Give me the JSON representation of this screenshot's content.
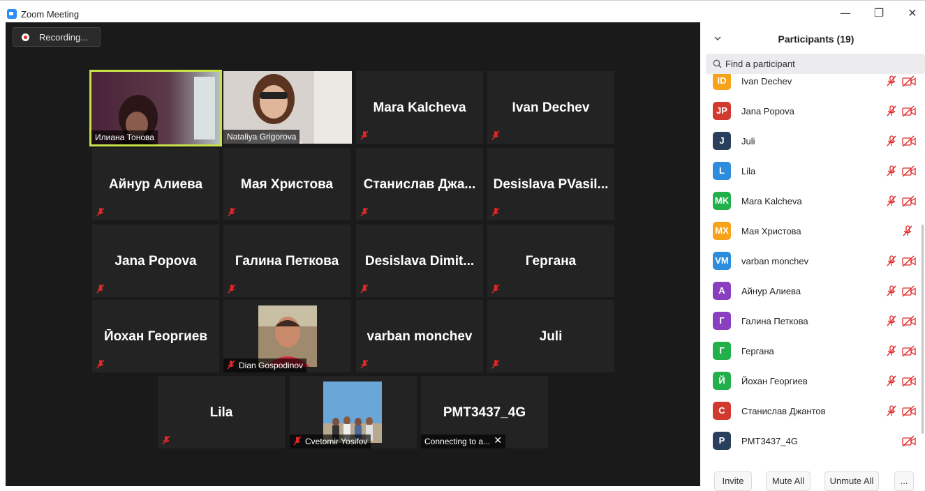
{
  "window": {
    "title": "Zoom Meeting",
    "minimize": "—",
    "restore": "❐",
    "close": "✕"
  },
  "recording": {
    "label": "Recording..."
  },
  "grid": {
    "tiles": [
      {
        "name": "Илиана Тонова",
        "label": "Илиана Тонова",
        "type": "video",
        "active": true
      },
      {
        "name": "Nataliya Grigorova",
        "label": "Nataliya Grigorova",
        "type": "video"
      },
      {
        "name": "Mara Kalcheva",
        "type": "name",
        "muted": true
      },
      {
        "name": "Ivan Dechev",
        "type": "name",
        "muted": true
      },
      {
        "name": "Айнур Алиева",
        "type": "name",
        "muted": true
      },
      {
        "name": "Мая Христова",
        "type": "name",
        "muted": true
      },
      {
        "name": "Станислав  Джа...",
        "type": "name",
        "muted": true
      },
      {
        "name": "Desislava  PVasil...",
        "type": "name",
        "muted": true
      },
      {
        "name": "Jana Popova",
        "type": "name",
        "muted": true
      },
      {
        "name": "Галина Петкова",
        "type": "name",
        "muted": true
      },
      {
        "name": "Desislava  Dimit...",
        "type": "name",
        "muted": true
      },
      {
        "name": "Гергана",
        "type": "name",
        "muted": true
      },
      {
        "name": "Йохан Георгиев",
        "type": "name",
        "muted": true
      },
      {
        "name": "Dian Gospodinov",
        "label": "Dian Gospodinov",
        "type": "video",
        "muted": true
      },
      {
        "name": "varban monchev",
        "type": "name",
        "muted": true
      },
      {
        "name": "Juli",
        "type": "name",
        "muted": true
      },
      {
        "name": "Lila",
        "type": "name",
        "muted": true
      },
      {
        "name": "Cvetomir Yosifov",
        "label": "Cvetomir Yosifov",
        "type": "video",
        "muted": true
      },
      {
        "name": "PMT3437_4G",
        "label": "Connecting to a...",
        "type": "connecting"
      }
    ]
  },
  "panel": {
    "title": "Participants (19)",
    "search_placeholder": "Find a participant",
    "participants": [
      {
        "initials": "ID",
        "name": "Ivan Dechev",
        "color": "#f7a21b",
        "mic_muted": true,
        "video_off": true
      },
      {
        "initials": "JP",
        "name": "Jana Popova",
        "color": "#d13b2f",
        "mic_muted": true,
        "video_off": true
      },
      {
        "initials": "J",
        "name": "Juli",
        "color": "#2a3f5c",
        "mic_muted": true,
        "video_off": true
      },
      {
        "initials": "L",
        "name": "Lila",
        "color": "#2d8cdc",
        "mic_muted": true,
        "video_off": true
      },
      {
        "initials": "MK",
        "name": "Mara Kalcheva",
        "color": "#22b04b",
        "mic_muted": true,
        "video_off": true
      },
      {
        "initials": "MX",
        "name": "Мая Христова",
        "color": "#f7a21b",
        "mic_muted": true,
        "video_off": false
      },
      {
        "initials": "VM",
        "name": "varban monchev",
        "color": "#2d8cdc",
        "mic_muted": true,
        "video_off": true
      },
      {
        "initials": "A",
        "name": "Айнур Алиева",
        "color": "#8a3fc0",
        "mic_muted": true,
        "video_off": true
      },
      {
        "initials": "Г",
        "name": "Галина Петкова",
        "color": "#8a3fc0",
        "mic_muted": true,
        "video_off": true
      },
      {
        "initials": "Г",
        "name": "Гергана",
        "color": "#22b04b",
        "mic_muted": true,
        "video_off": true
      },
      {
        "initials": "Й",
        "name": "Йохан Георгиев",
        "color": "#22b04b",
        "mic_muted": true,
        "video_off": true
      },
      {
        "initials": "С",
        "name": "Станислав Джантов",
        "color": "#d13b2f",
        "mic_muted": true,
        "video_off": true
      },
      {
        "initials": "P",
        "name": "PMT3437_4G",
        "color": "#2a3f5c",
        "mic_muted": false,
        "video_off": true
      }
    ],
    "buttons": {
      "invite": "Invite",
      "mute_all": "Mute All",
      "unmute_all": "Unmute All",
      "more": "..."
    }
  },
  "colors": {
    "accent": "#2d8cff",
    "muted_red": "#e02828",
    "active_border": "#c8e04a"
  }
}
